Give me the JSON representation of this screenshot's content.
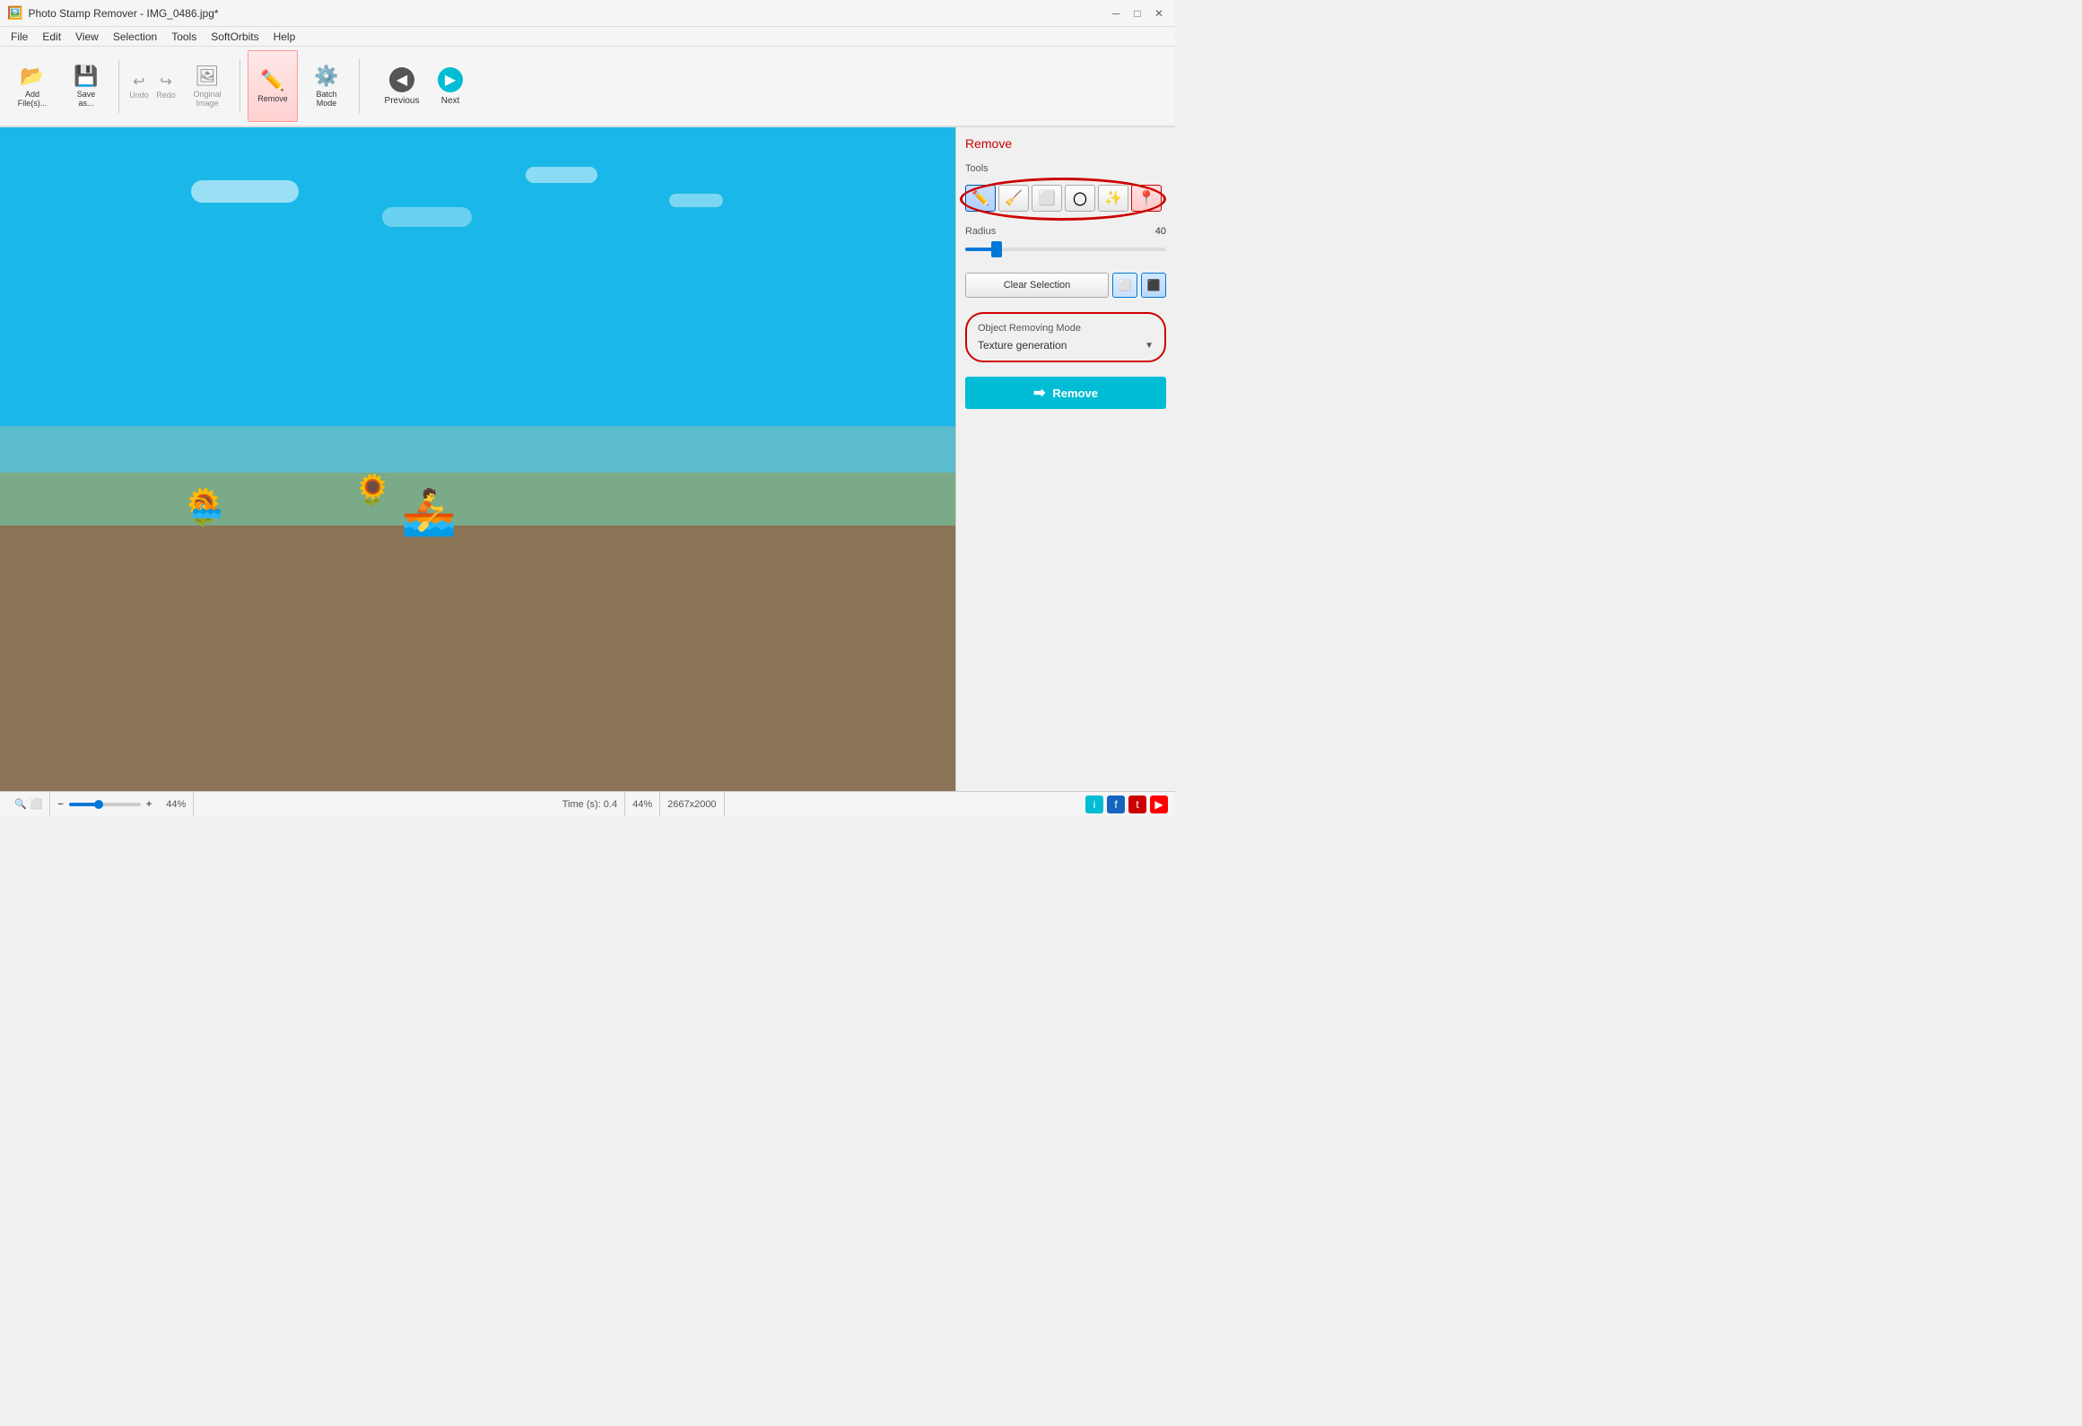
{
  "titlebar": {
    "title": "Photo Stamp Remover - IMG_0486.jpg*",
    "icon": "🖼️"
  },
  "menubar": {
    "items": [
      "File",
      "Edit",
      "View",
      "Selection",
      "Tools",
      "SoftOrbits",
      "Help"
    ]
  },
  "toolbar": {
    "buttons": [
      {
        "id": "add-files",
        "icon": "📂",
        "label": "Add\nFile(s)..."
      },
      {
        "id": "save",
        "icon": "💾",
        "label": "Save\nas..."
      },
      {
        "id": "undo",
        "icon": "↩",
        "label": "Undo"
      },
      {
        "id": "redo",
        "icon": "↪",
        "label": "Redo"
      },
      {
        "id": "original-image",
        "icon": "🖼",
        "label": "Original\nImage"
      },
      {
        "id": "remove",
        "icon": "✏️",
        "label": "Remove"
      },
      {
        "id": "batch-mode",
        "icon": "⚙️",
        "label": "Batch\nMode"
      }
    ],
    "nav": {
      "previous": "Previous",
      "next": "Next"
    }
  },
  "right_panel": {
    "section_title": "Remove",
    "tools_label": "Tools",
    "tools": [
      {
        "id": "brush",
        "icon": "✏️",
        "active": true
      },
      {
        "id": "eraser",
        "icon": "🧹",
        "active": false
      },
      {
        "id": "rect-select",
        "icon": "⬜",
        "active": false
      },
      {
        "id": "lasso",
        "icon": "🔗",
        "active": false
      },
      {
        "id": "magic-wand",
        "icon": "✨",
        "active": false
      },
      {
        "id": "stamp",
        "icon": "📍",
        "active": false
      }
    ],
    "radius_label": "Radius",
    "radius_value": "40",
    "radius_percent": 15,
    "clear_selection_label": "Clear Selection",
    "mode_section": {
      "mode_label": "Object Removing Mode",
      "mode_value": "Texture generation",
      "has_dropdown": true
    },
    "remove_btn_label": "Remove"
  },
  "statusbar": {
    "zoom_icons": [
      "🔍",
      "⬜"
    ],
    "zoom_minus": "−",
    "zoom_plus": "+",
    "zoom_value": "44%",
    "time_label": "Time (s): 0.4",
    "zoom_display": "44%",
    "dimensions": "2667x2000",
    "social": [
      "i",
      "f",
      "t",
      "▶"
    ]
  }
}
